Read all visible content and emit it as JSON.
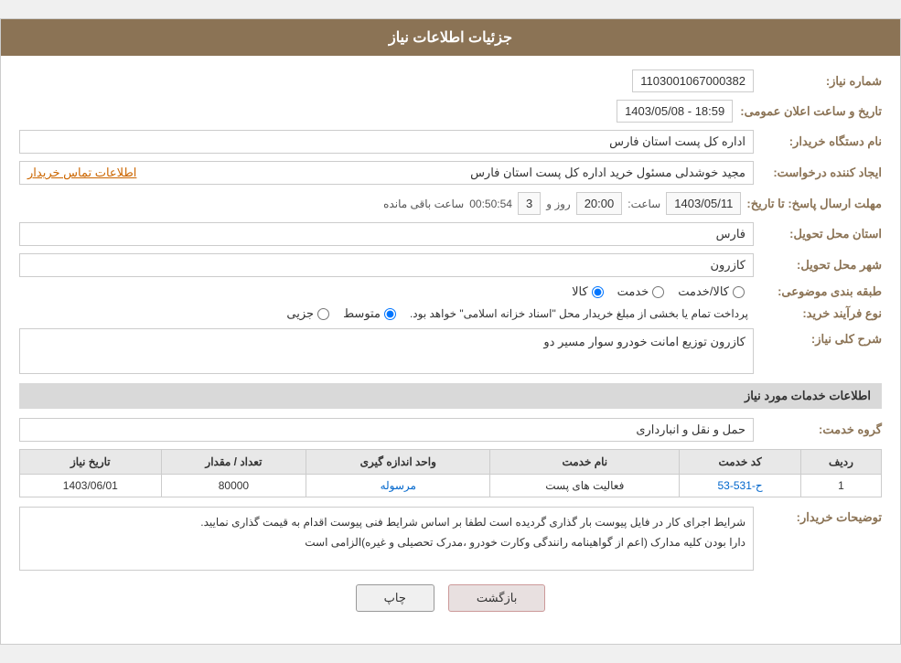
{
  "header": {
    "title": "جزئیات اطلاعات نیاز"
  },
  "fields": {
    "need_number_label": "شماره نیاز:",
    "need_number_value": "1103001067000382",
    "announcement_date_label": "تاریخ و ساعت اعلان عمومی:",
    "announcement_date_value": "1403/05/08 - 18:59",
    "buyer_name_label": "نام دستگاه خریدار:",
    "buyer_name_value": "اداره کل پست استان فارس",
    "creator_label": "ایجاد کننده درخواست:",
    "creator_value": "مجید خوشدلی مسئول خرید اداره کل پست استان فارس",
    "creator_contact_label": "اطلاعات تماس خریدار",
    "deadline_label": "مهلت ارسال پاسخ: تا تاریخ:",
    "deadline_date": "1403/05/11",
    "deadline_time_label": "ساعت:",
    "deadline_time": "20:00",
    "deadline_days_label": "روز و",
    "deadline_days": "3",
    "deadline_remaining_label": "ساعت باقی مانده",
    "deadline_remaining": "00:50:54",
    "province_label": "استان محل تحویل:",
    "province_value": "فارس",
    "city_label": "شهر محل تحویل:",
    "city_value": "کازرون",
    "category_label": "طبقه بندی موضوعی:",
    "category_options": [
      "کالا",
      "خدمت",
      "کالا/خدمت"
    ],
    "category_selected": "کالا",
    "process_label": "نوع فرآیند خرید:",
    "process_options": [
      "جزیی",
      "متوسط"
    ],
    "process_selected": "متوسط",
    "process_note": "پرداخت تمام یا بخشی از مبلغ خریدار محل \"اسناد خزانه اسلامی\" خواهد بود.",
    "need_desc_label": "شرح کلی نیاز:",
    "need_desc_value": "کازرون توزیع امانت خودرو سوار مسیر دو",
    "services_section_title": "اطلاعات خدمات مورد نیاز",
    "service_group_label": "گروه خدمت:",
    "service_group_value": "حمل و نقل و انبارداری",
    "table_headers": [
      "ردیف",
      "کد خدمت",
      "نام خدمت",
      "واحد اندازه گیری",
      "تعداد / مقدار",
      "تاریخ نیاز"
    ],
    "table_rows": [
      {
        "row": "1",
        "code": "ح-531-53",
        "name": "فعالیت های پست",
        "unit": "مرسوله",
        "quantity": "80000",
        "date": "1403/06/01"
      }
    ],
    "buyer_desc_label": "توضیحات خریدار:",
    "buyer_desc_value": "شرایط اجرای کار در فایل پیوست بار گذاری گردیده است لطفا بر اساس شرایط فنی پیوست اقدام به قیمت گذاری نمایید.\nدارا بودن کلیه مدارک (اعم از گواهینامه رانندگی وکارت خودرو ،مدرک تحصیلی و غیره)الزامی است"
  },
  "buttons": {
    "print_label": "چاپ",
    "back_label": "بازگشت"
  }
}
